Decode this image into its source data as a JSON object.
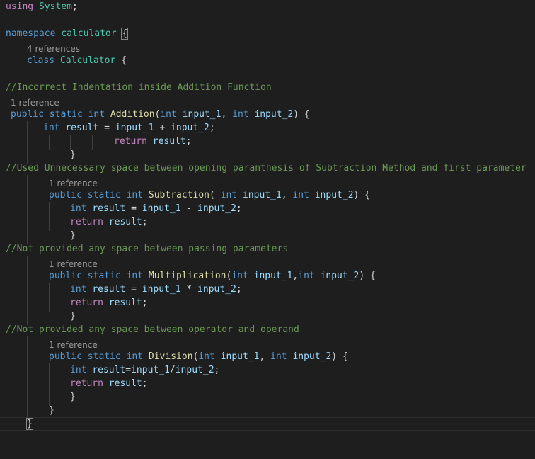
{
  "code": {
    "l1_using": "using",
    "l1_system": "System",
    "l1_semi": ";",
    "l3_namespace": "namespace",
    "l3_name": "calculator",
    "l3_brace": "{",
    "lens_ns": "4 references",
    "l5_class": "class",
    "l5_name": "Calculator",
    "l5_brace": "{",
    "c1": "//Incorrect Indentation inside Addition Function",
    "lens_add": "1 reference",
    "add_public": "public",
    "add_static": "static",
    "add_int": "int",
    "add_name": "Addition",
    "add_open": "(",
    "add_int1": "int",
    "add_p1": "input_1",
    "add_comma": ",",
    "add_int2": "int",
    "add_p2": "input_2",
    "add_close": ") {",
    "add_b_int": "int",
    "add_b_var": "result",
    "add_b_eq": "=",
    "add_b_a": "input_1",
    "add_b_op": "+",
    "add_b_b": "input_2",
    "add_b_semi": ";",
    "add_ret": "return",
    "add_ret_var": "result",
    "add_ret_semi": ";",
    "add_end": "}",
    "c2": "//Used Unnecessary space between opening paranthesis of Subtraction Method and first parameter",
    "lens_sub": "1 reference",
    "sub_public": "public",
    "sub_static": "static",
    "sub_int": "int",
    "sub_name": "Subtraction",
    "sub_open": "( ",
    "sub_int1": "int",
    "sub_p1": "input_1",
    "sub_comma": ",",
    "sub_int2": "int",
    "sub_p2": "input_2",
    "sub_close": ") {",
    "sub_b_int": "int",
    "sub_b_var": "result",
    "sub_b_eq": "=",
    "sub_b_a": "input_1",
    "sub_b_op": "-",
    "sub_b_b": "input_2",
    "sub_b_semi": ";",
    "sub_ret": "return",
    "sub_ret_var": "result",
    "sub_ret_semi": ";",
    "sub_end": "}",
    "c3": "//Not provided any space between passing parameters",
    "lens_mul": "1 reference",
    "mul_public": "public",
    "mul_static": "static",
    "mul_int": "int",
    "mul_name": "Multiplication",
    "mul_open": "(",
    "mul_int1": "int",
    "mul_p1": "input_1",
    "mul_comma": ",",
    "mul_int2": "int",
    "mul_p2": "input_2",
    "mul_close": ") {",
    "mul_b_int": "int",
    "mul_b_var": "result",
    "mul_b_eq": "=",
    "mul_b_a": "input_1",
    "mul_b_op": "*",
    "mul_b_b": "input_2",
    "mul_b_semi": ";",
    "mul_ret": "return",
    "mul_ret_var": "result",
    "mul_ret_semi": ";",
    "mul_end": "}",
    "c4": "//Not provided any space between operator and operand",
    "lens_div": "1 reference",
    "div_public": "public",
    "div_static": "static",
    "div_int": "int",
    "div_name": "Division",
    "div_open": "(",
    "div_int1": "int",
    "div_p1": "input_1",
    "div_comma": ",",
    "div_int2": "int",
    "div_p2": "input_2",
    "div_close": ") {",
    "div_b_int": "int",
    "div_b_var": "result",
    "div_b_eq": "=",
    "div_b_a": "input_1",
    "div_b_op": "/",
    "div_b_b": "input_2",
    "div_b_semi": ";",
    "div_ret": "return",
    "div_ret_var": "result",
    "div_ret_semi": ";",
    "div_end": "}",
    "class_end": "}",
    "ns_end": "}"
  },
  "colors": {
    "background": "#1e1e1e",
    "keyword": "#569cd6",
    "control": "#c586c0",
    "type": "#4ec9b0",
    "function": "#dcdcaa",
    "variable": "#9cdcfe",
    "comment": "#6a9955",
    "codelens": "#999999"
  }
}
